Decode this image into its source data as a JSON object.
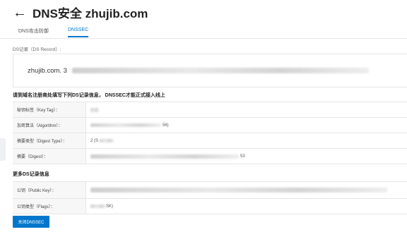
{
  "header": {
    "title": "DNS安全 zhujib.com"
  },
  "tabs": [
    {
      "label": "DNS攻击防御"
    },
    {
      "label": "DNSSEC"
    }
  ],
  "ds_record": {
    "label": "DS记录（DS Record）:",
    "value_prefix": "zhujib.com. 3"
  },
  "section1": {
    "title": "请到域名注册商处填写下列DS记录信息， DNSSEC才能正式接入线上",
    "rows": [
      {
        "label": "秘钥标签（Key Tag）：",
        "value": ""
      },
      {
        "label": "加密算法（Algorithm）：",
        "value": "56)"
      },
      {
        "label": "摘要类型（Digest Type）：",
        "value": "2 (S"
      },
      {
        "label": "摘要（Digest）：",
        "value": "53"
      }
    ]
  },
  "section2": {
    "title": "更多DS记录信息",
    "rows": [
      {
        "label": "公钥（Public Key）：",
        "value": ""
      },
      {
        "label": "公钥类型（Flags）：",
        "value": "SK)"
      }
    ]
  },
  "button": {
    "label": "关闭DNSSEC"
  }
}
